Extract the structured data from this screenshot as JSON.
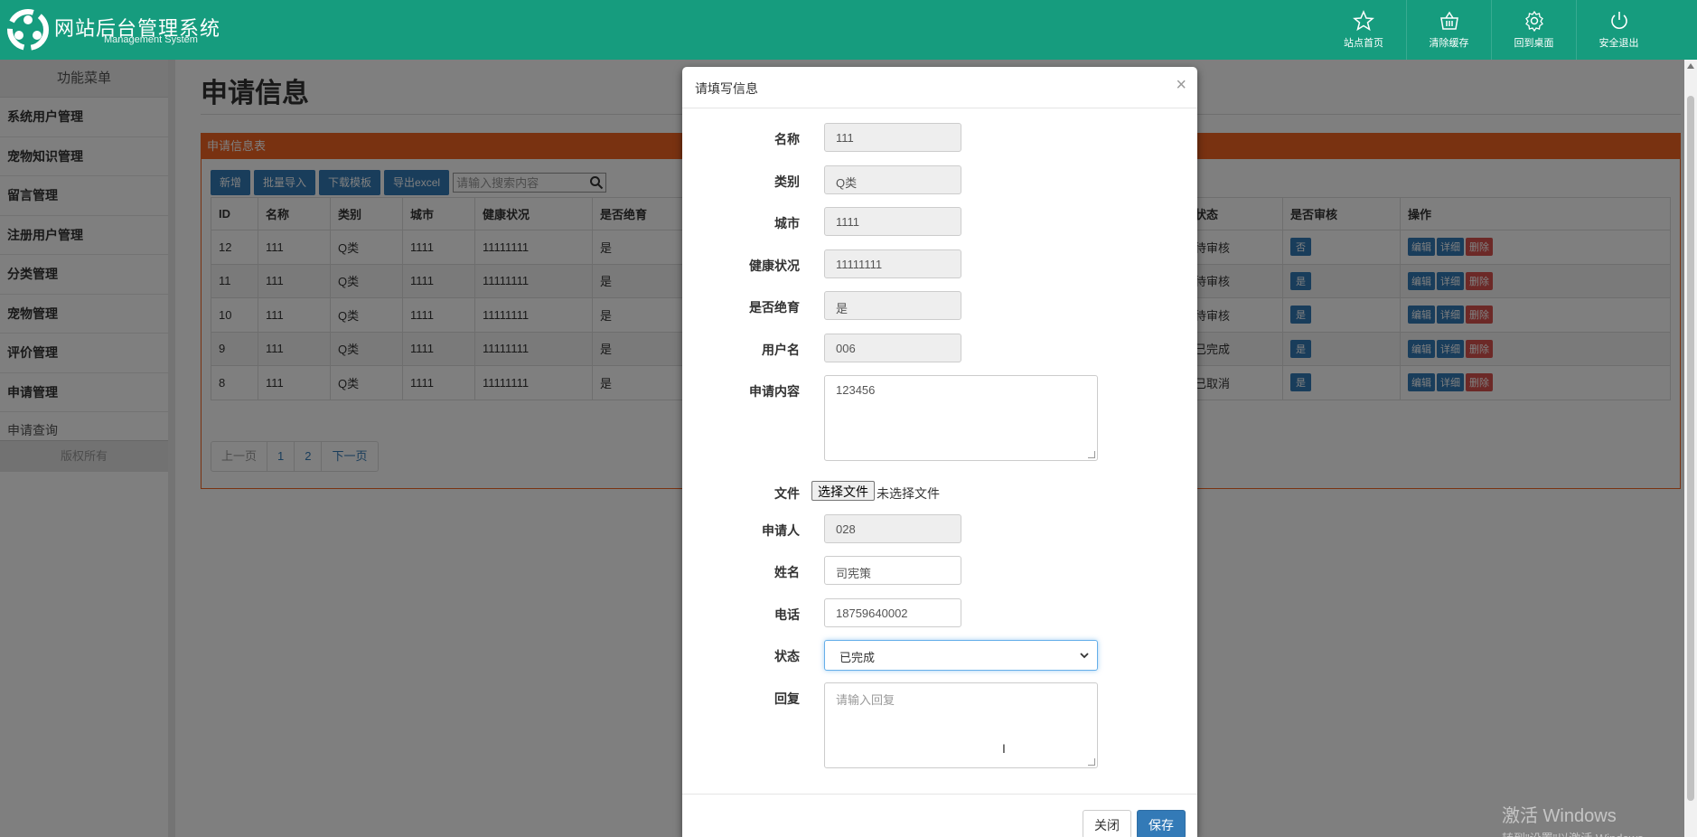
{
  "header": {
    "title": "网站后台管理系统",
    "subtitle": "Management System",
    "nav": [
      {
        "label": "站点首页",
        "icon": "star-icon"
      },
      {
        "label": "清除缓存",
        "icon": "basket-icon"
      },
      {
        "label": "回到桌面",
        "icon": "gear-icon"
      },
      {
        "label": "安全退出",
        "icon": "power-icon"
      }
    ]
  },
  "sidebar": {
    "heading": "功能菜单",
    "items": [
      "系统用户管理",
      "宠物知识管理",
      "留言管理",
      "注册用户管理",
      "分类管理",
      "宠物管理",
      "评价管理",
      "申请管理"
    ],
    "sub_item": "申请查询",
    "footer": "版权所有"
  },
  "main": {
    "title": "申请信息",
    "panel_title": "申请信息表",
    "toolbar": [
      "新增",
      "批量导入",
      "下载模板",
      "导出excel"
    ],
    "search_placeholder": "请输入搜索内容",
    "columns_left": [
      "ID",
      "名称",
      "类别",
      "城市",
      "健康状况",
      "是否绝育"
    ],
    "columns_right": [
      "状态",
      "是否审核",
      "操作"
    ],
    "rows": [
      {
        "id": "12",
        "name": "111",
        "cat": "Q类",
        "city": "1111",
        "health": "11111111",
        "neuter": "是",
        "status": "待审核",
        "audit": "否"
      },
      {
        "id": "11",
        "name": "111",
        "cat": "Q类",
        "city": "1111",
        "health": "11111111",
        "neuter": "是",
        "status": "待审核",
        "audit": "是"
      },
      {
        "id": "10",
        "name": "111",
        "cat": "Q类",
        "city": "1111",
        "health": "11111111",
        "neuter": "是",
        "status": "待审核",
        "audit": "是"
      },
      {
        "id": "9",
        "name": "111",
        "cat": "Q类",
        "city": "1111",
        "health": "11111111",
        "neuter": "是",
        "status": "已完成",
        "audit": "是"
      },
      {
        "id": "8",
        "name": "111",
        "cat": "Q类",
        "city": "1111",
        "health": "11111111",
        "neuter": "是",
        "status": "已取消",
        "audit": "是"
      }
    ],
    "actions": {
      "edit": "编辑",
      "detail": "详细",
      "delete": "删除"
    },
    "pager": [
      "上一页",
      "1",
      "2",
      "下一页"
    ]
  },
  "modal": {
    "title": "请填写信息",
    "close": "×",
    "fields": {
      "name": {
        "label": "名称",
        "value": "111"
      },
      "category": {
        "label": "类别",
        "value": "Q类"
      },
      "city": {
        "label": "城市",
        "value": "1111"
      },
      "health": {
        "label": "健康状况",
        "value": "11111111"
      },
      "neuter": {
        "label": "是否绝育",
        "value": "是"
      },
      "username": {
        "label": "用户名",
        "value": "006"
      },
      "content": {
        "label": "申请内容",
        "value": "123456"
      },
      "file": {
        "label": "文件",
        "button": "选择文件",
        "status": "未选择文件"
      },
      "applicant": {
        "label": "申请人",
        "value": "028"
      },
      "realname": {
        "label": "姓名",
        "value": "司宪策"
      },
      "phone": {
        "label": "电话",
        "value": "18759640002"
      },
      "status": {
        "label": "状态",
        "value": "已完成"
      },
      "reply": {
        "label": "回复",
        "placeholder": "请输入回复"
      }
    },
    "buttons": {
      "close": "关闭",
      "save": "保存"
    }
  },
  "watermark": {
    "line1": "激活 Windows",
    "line2": "转到\"设置\"以激活 Windows。"
  },
  "colors": {
    "header": "#169c7e",
    "panel": "#f26522",
    "primary": "#337ab7",
    "danger": "#d9534f"
  }
}
